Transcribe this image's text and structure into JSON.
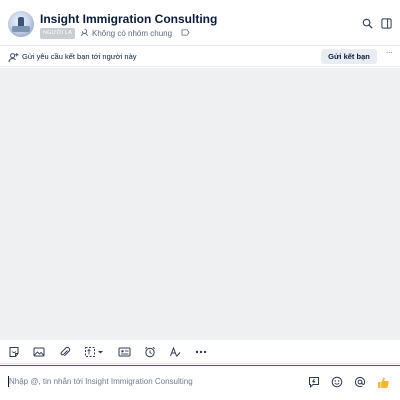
{
  "conversation": {
    "name": "Insight Immigration Consulting",
    "relation_tag": "NGƯỜI LẠ",
    "group_info": "Không có nhóm chung"
  },
  "friend_request": {
    "text": "Gửi yêu cầu kết bạn tới người này",
    "button_label": "Gửi kết bạn",
    "more_label": "···"
  },
  "toolbar": {
    "items": [
      "sticker-icon",
      "image-icon",
      "attachment-icon",
      "screenshot-icon",
      "contact-card-icon",
      "reminder-icon",
      "text-format-icon",
      "more-icon"
    ]
  },
  "composer": {
    "placeholder": "Nhập @, tin nhắn tới Insight Immigration Consulting",
    "icons": [
      "quick-message-icon",
      "emoji-icon",
      "mention-icon",
      "thumbs-up-icon"
    ]
  },
  "colors": {
    "accent": "#0068ff",
    "chat_background": "#eef0f1",
    "tag_background": "#c8cdd4",
    "thumbs_up": "#f5b62b"
  }
}
